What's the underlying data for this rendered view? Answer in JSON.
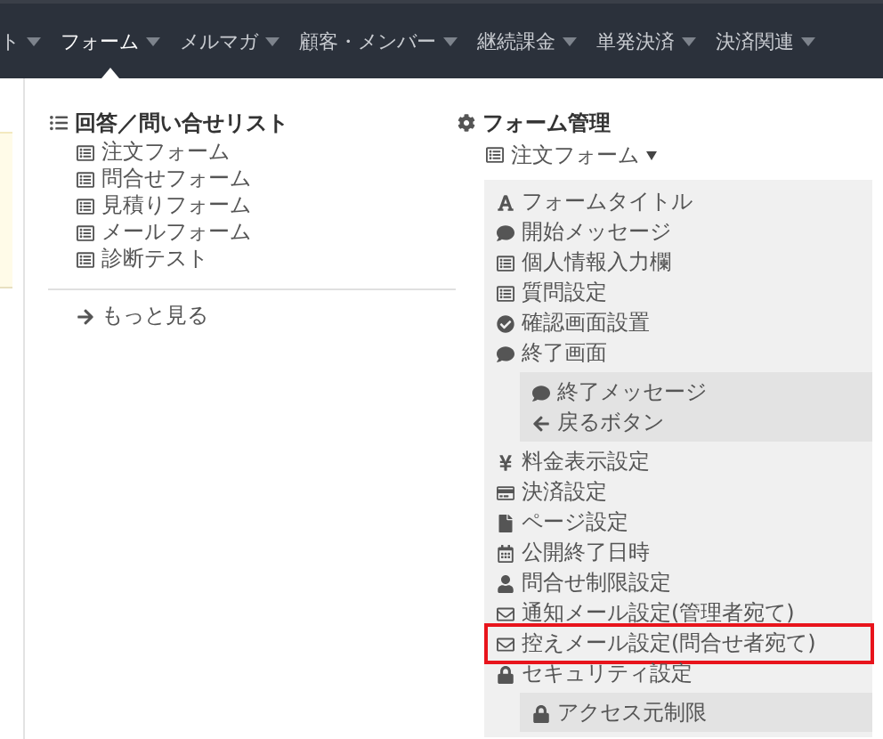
{
  "nav": {
    "items": [
      {
        "label": "ト",
        "selected": false
      },
      {
        "label": "フォーム",
        "selected": true
      },
      {
        "label": "メルマガ",
        "selected": false
      },
      {
        "label": "顧客・メンバー",
        "selected": false
      },
      {
        "label": "継続課金",
        "selected": false
      },
      {
        "label": "単発決済",
        "selected": false
      },
      {
        "label": "決済関連",
        "selected": false
      }
    ]
  },
  "menu": {
    "left": {
      "heading": "回答／問い合せリスト",
      "items": [
        {
          "label": "注文フォーム",
          "kind": "form"
        },
        {
          "label": "問合せフォーム",
          "kind": "form"
        },
        {
          "label": "見積りフォーム",
          "kind": "form"
        },
        {
          "label": "メールフォーム",
          "kind": "form"
        },
        {
          "label": "診断テスト",
          "kind": "form"
        }
      ],
      "more": "もっと見る"
    },
    "right": {
      "heading": "フォーム管理",
      "form_selector": "注文フォーム",
      "items": [
        {
          "label": "フォームタイトル",
          "kind": "title",
          "highlighted": false
        },
        {
          "label": "開始メッセージ",
          "kind": "message",
          "highlighted": false
        },
        {
          "label": "個人情報入力欄",
          "kind": "form",
          "highlighted": false
        },
        {
          "label": "質問設定",
          "kind": "form",
          "highlighted": false
        },
        {
          "label": "確認画面設置",
          "kind": "check",
          "highlighted": false
        },
        {
          "label": "終了画面",
          "kind": "message",
          "highlighted": false,
          "children": [
            {
              "label": "終了メッセージ",
              "kind": "message"
            },
            {
              "label": "戻るボタン",
              "kind": "back"
            }
          ]
        },
        {
          "label": "料金表示設定",
          "kind": "price",
          "highlighted": false
        },
        {
          "label": "決済設定",
          "kind": "payment",
          "highlighted": false
        },
        {
          "label": "ページ設定",
          "kind": "page",
          "highlighted": false
        },
        {
          "label": "公開終了日時",
          "kind": "calendar",
          "highlighted": false
        },
        {
          "label": "問合せ制限設定",
          "kind": "user",
          "highlighted": false
        },
        {
          "label": "通知メール設定(管理者宛て)",
          "kind": "mail",
          "highlighted": false
        },
        {
          "label": "控えメール設定(問合せ者宛て)",
          "kind": "mail",
          "highlighted": true
        },
        {
          "label": "セキュリティ設定",
          "kind": "lock",
          "highlighted": false,
          "children": [
            {
              "label": "アクセス元制限",
              "kind": "lock"
            }
          ]
        }
      ]
    }
  }
}
